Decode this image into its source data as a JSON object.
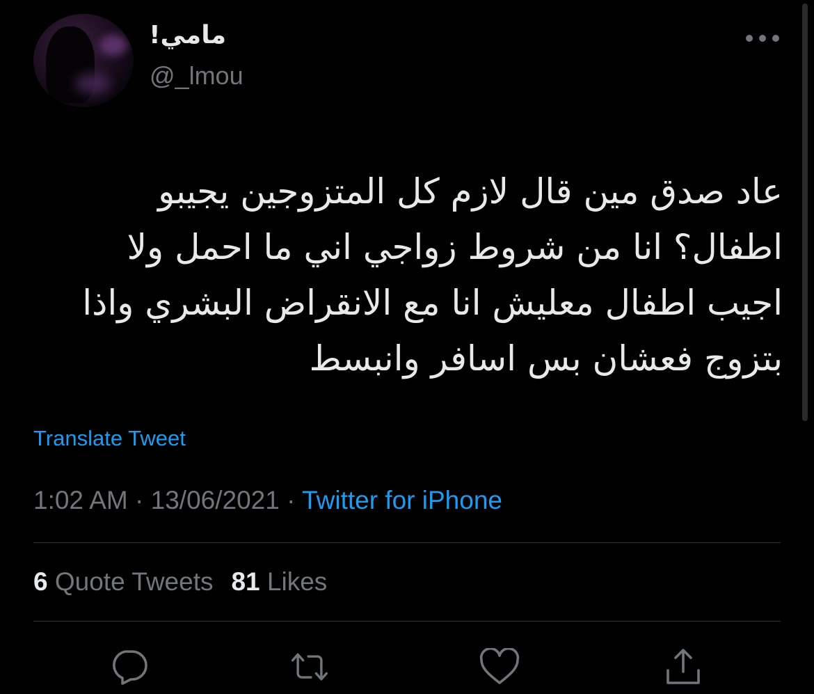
{
  "tweet": {
    "display_name": "مامي!",
    "handle": "@_lmou",
    "text": "عاد صدق مين قال لازم كل المتزوجين يجيبو\nاطفال؟ انا من شروط زواجي اني ما احمل ولا\nاجيب اطفال معليش انا مع الانقراض البشري واذا\nبتزوج فعشان بس اسافر وانبسط",
    "translate_label": "Translate Tweet",
    "time": "1:02 AM",
    "date": "13/06/2021",
    "separator": "·",
    "source": "Twitter for iPhone"
  },
  "stats": {
    "quote_count": "6",
    "quote_label": "Quote Tweets",
    "like_count": "81",
    "like_label": "Likes"
  },
  "icons": {
    "more": "more-horizontal-icon",
    "reply": "reply-icon",
    "retweet": "retweet-icon",
    "like": "heart-icon",
    "share": "share-icon"
  },
  "colors": {
    "background": "#000000",
    "text": "#e7e9ea",
    "secondary": "#71767b",
    "link": "#1d9bf0",
    "divider": "#2f3336"
  }
}
